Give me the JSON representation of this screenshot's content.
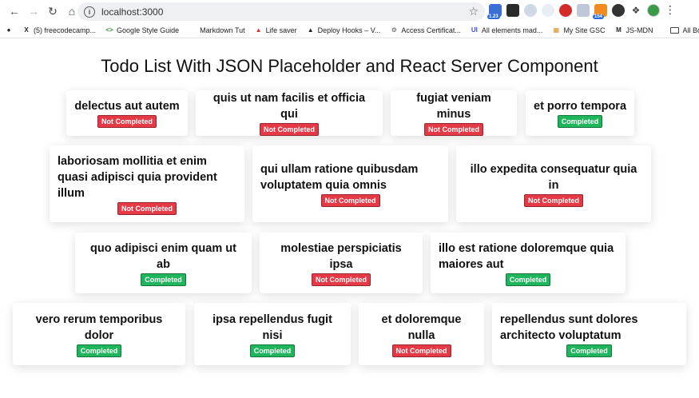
{
  "browser": {
    "url": "localhost:3000",
    "extension_badges": [
      "1.23",
      "154"
    ],
    "bookmarks": [
      {
        "label": "(5) freecodecamp...",
        "icon": "x-icon"
      },
      {
        "label": "Google Style Guide",
        "icon": "code-icon"
      },
      {
        "label": "Markdown Tut",
        "icon": "blank-icon"
      },
      {
        "label": "Life saver",
        "icon": "flame-icon"
      },
      {
        "label": "Deploy Hooks – V...",
        "icon": "vercel-icon"
      },
      {
        "label": "Access Certificat...",
        "icon": "gear-icon"
      },
      {
        "label": "All elements mad...",
        "icon": "ui-icon"
      },
      {
        "label": "My Site GSC",
        "icon": "chart-icon"
      },
      {
        "label": "JS-MDN",
        "icon": "mdn-icon"
      }
    ],
    "all_bookmarks_label": "All Bookmarks"
  },
  "page": {
    "title": "Todo List With JSON Placeholder and React Server Component"
  },
  "todos": [
    {
      "title": "delectus aut autem",
      "status": "Not Completed"
    },
    {
      "title": "quis ut nam facilis et officia qui",
      "status": "Not Completed"
    },
    {
      "title": "fugiat veniam minus",
      "status": "Not Completed"
    },
    {
      "title": "et porro tempora",
      "status": "Completed"
    },
    {
      "title": "laboriosam mollitia et enim quasi adipisci quia provident illum",
      "status": "Not Completed"
    },
    {
      "title": "qui ullam ratione quibusdam voluptatem quia omnis",
      "status": "Not Completed"
    },
    {
      "title": "illo expedita consequatur quia in",
      "status": "Not Completed"
    },
    {
      "title": "quo adipisci enim quam ut ab",
      "status": "Completed"
    },
    {
      "title": "molestiae perspiciatis ipsa",
      "status": "Not Completed"
    },
    {
      "title": "illo est ratione doloremque quia maiores aut",
      "status": "Completed"
    },
    {
      "title": "vero rerum temporibus dolor",
      "status": "Completed"
    },
    {
      "title": "ipsa repellendus fugit nisi",
      "status": "Completed"
    },
    {
      "title": "et doloremque nulla",
      "status": "Not Completed"
    },
    {
      "title": "repellendus sunt dolores architecto voluptatum",
      "status": "Completed"
    }
  ],
  "colors": {
    "not_completed": "#e63946",
    "completed": "#1fb55c"
  }
}
